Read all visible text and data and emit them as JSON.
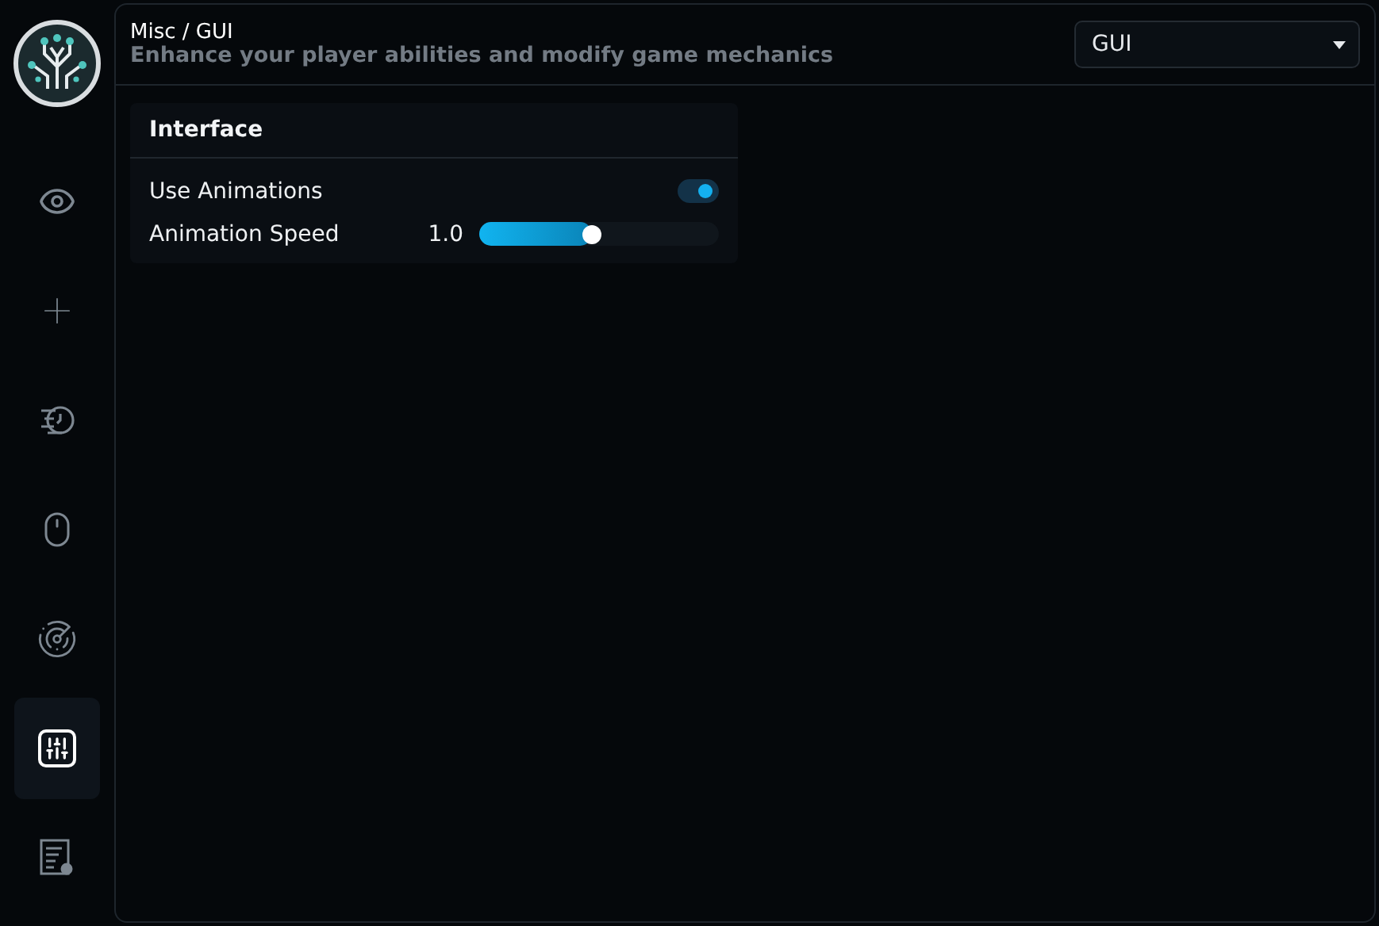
{
  "sidebar": {
    "items": [
      {
        "selected": false
      },
      {
        "selected": false
      },
      {
        "selected": false
      },
      {
        "selected": false
      },
      {
        "selected": false
      },
      {
        "selected": true
      },
      {
        "selected": false
      }
    ]
  },
  "header": {
    "title": "Misc / GUI",
    "subtitle": "Enhance your player abilities and modify game mechanics",
    "dropdown": {
      "value": "GUI"
    }
  },
  "section": {
    "title": "Interface",
    "settings": [
      {
        "kind": "toggle",
        "label": "Use Animations",
        "on": true
      },
      {
        "kind": "slider",
        "label": "Animation Speed",
        "reading": "1.0",
        "level": 0.47
      }
    ]
  }
}
